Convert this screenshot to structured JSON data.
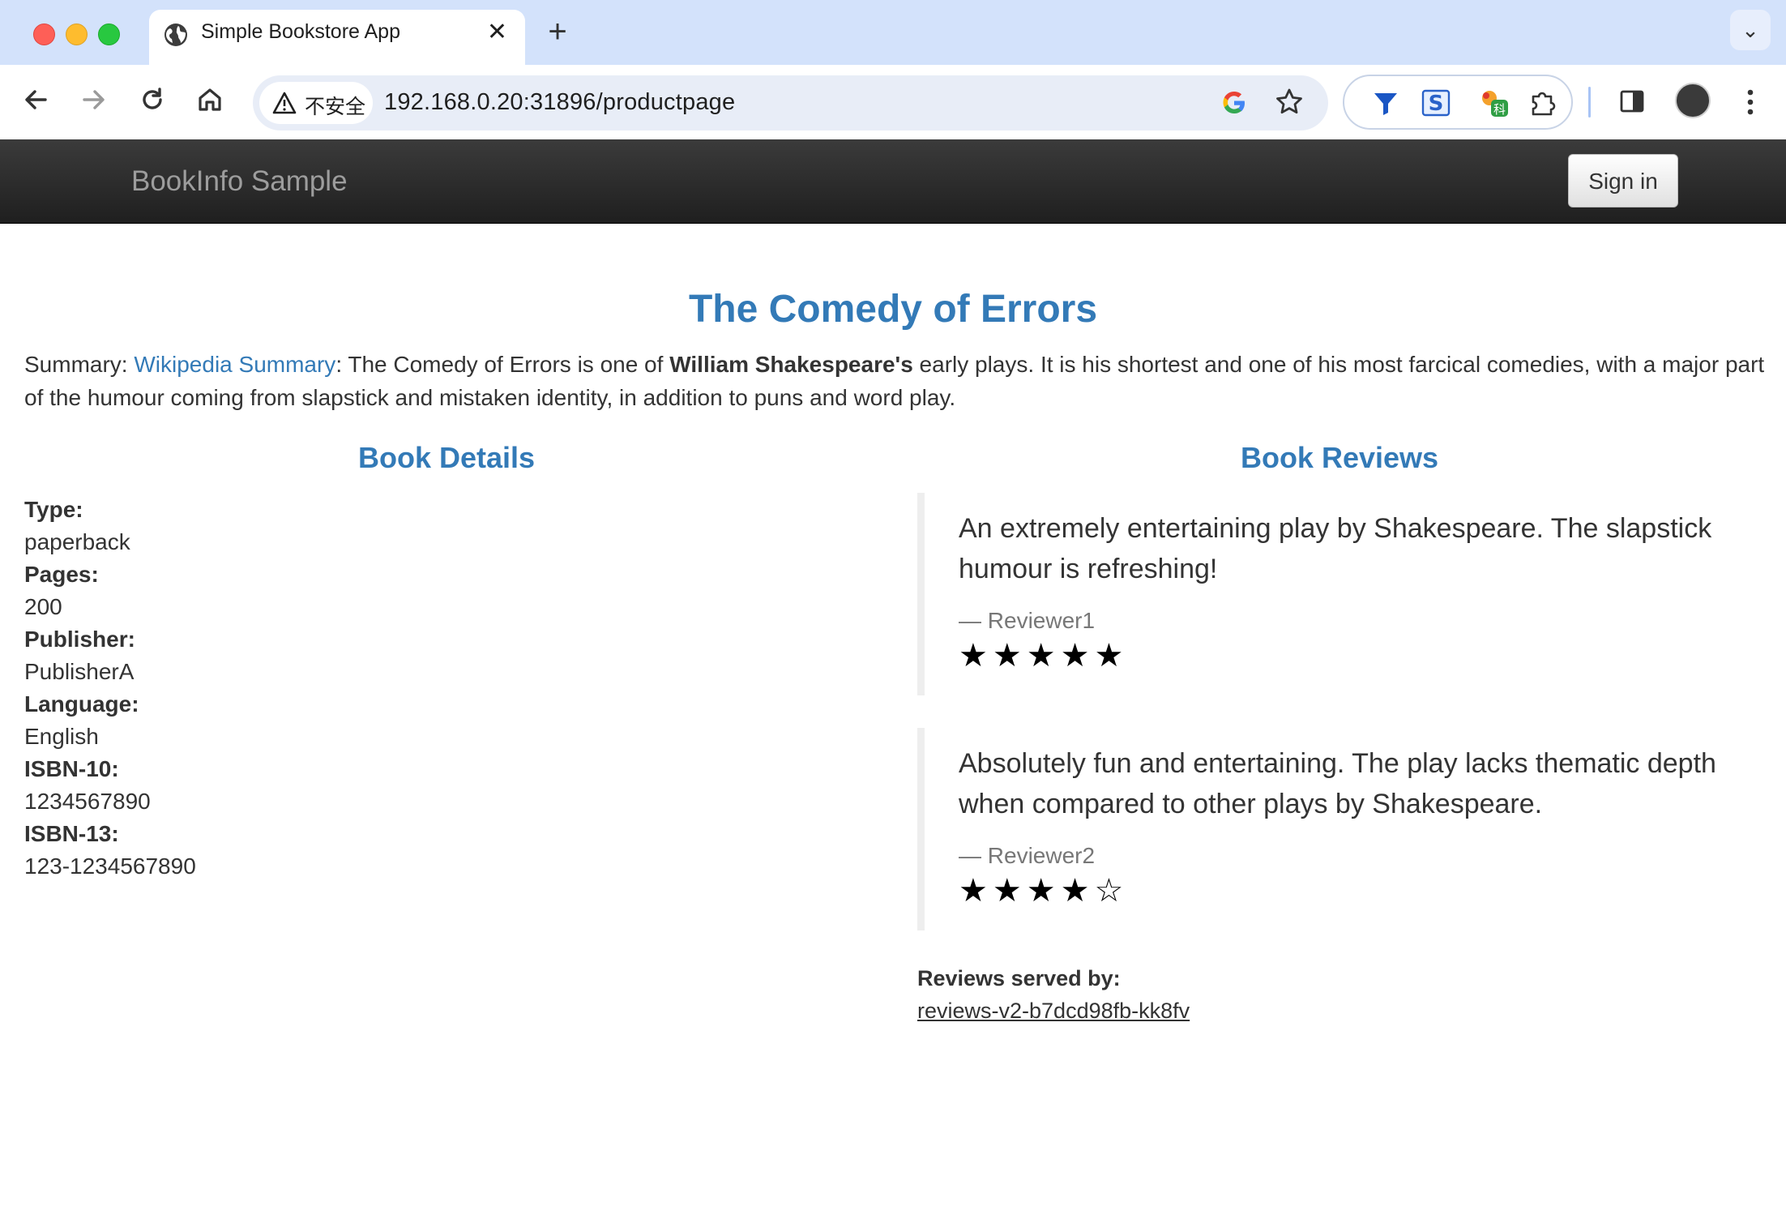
{
  "browser": {
    "tab_title": "Simple Bookstore App",
    "tab_close": "✕",
    "new_tab": "+",
    "tab_search": "⌄",
    "security_label": "不安全",
    "url": "192.168.0.20:31896/productpage"
  },
  "navbar": {
    "brand": "BookInfo Sample",
    "signin_label": "Sign in"
  },
  "book": {
    "title": "The Comedy of Errors",
    "summary_prefix": "Summary: ",
    "summary_link": "Wikipedia Summary",
    "summary_mid": ": The Comedy of Errors is one of ",
    "summary_bold": "William Shakespeare's",
    "summary_rest": " early plays. It is his shortest and one of his most farcical comedies, with a major part of the humour coming from slapstick and mistaken identity, in addition to puns and word play."
  },
  "details": {
    "heading": "Book Details",
    "fields": [
      {
        "label": "Type:",
        "value": "paperback"
      },
      {
        "label": "Pages:",
        "value": "200"
      },
      {
        "label": "Publisher:",
        "value": "PublisherA"
      },
      {
        "label": "Language:",
        "value": "English"
      },
      {
        "label": "ISBN-10:",
        "value": "1234567890"
      },
      {
        "label": "ISBN-13:",
        "value": "123-1234567890"
      }
    ]
  },
  "reviews": {
    "heading": "Book Reviews",
    "items": [
      {
        "text": "An extremely entertaining play by Shakespeare. The slapstick humour is refreshing!",
        "author": "— Reviewer1",
        "rating": 5,
        "stars": "★★★★★"
      },
      {
        "text": "Absolutely fun and entertaining. The play lacks thematic depth when compared to other plays by Shakespeare.",
        "author": "— Reviewer2",
        "rating": 4,
        "stars": "★★★★☆"
      }
    ],
    "served_by_label": "Reviews served by:",
    "served_by_value": "reviews-v2-b7dcd98fb-kk8fv"
  },
  "colors": {
    "link": "#337ab7",
    "navbar": "#222222",
    "chrome": "#d3e2fb"
  }
}
